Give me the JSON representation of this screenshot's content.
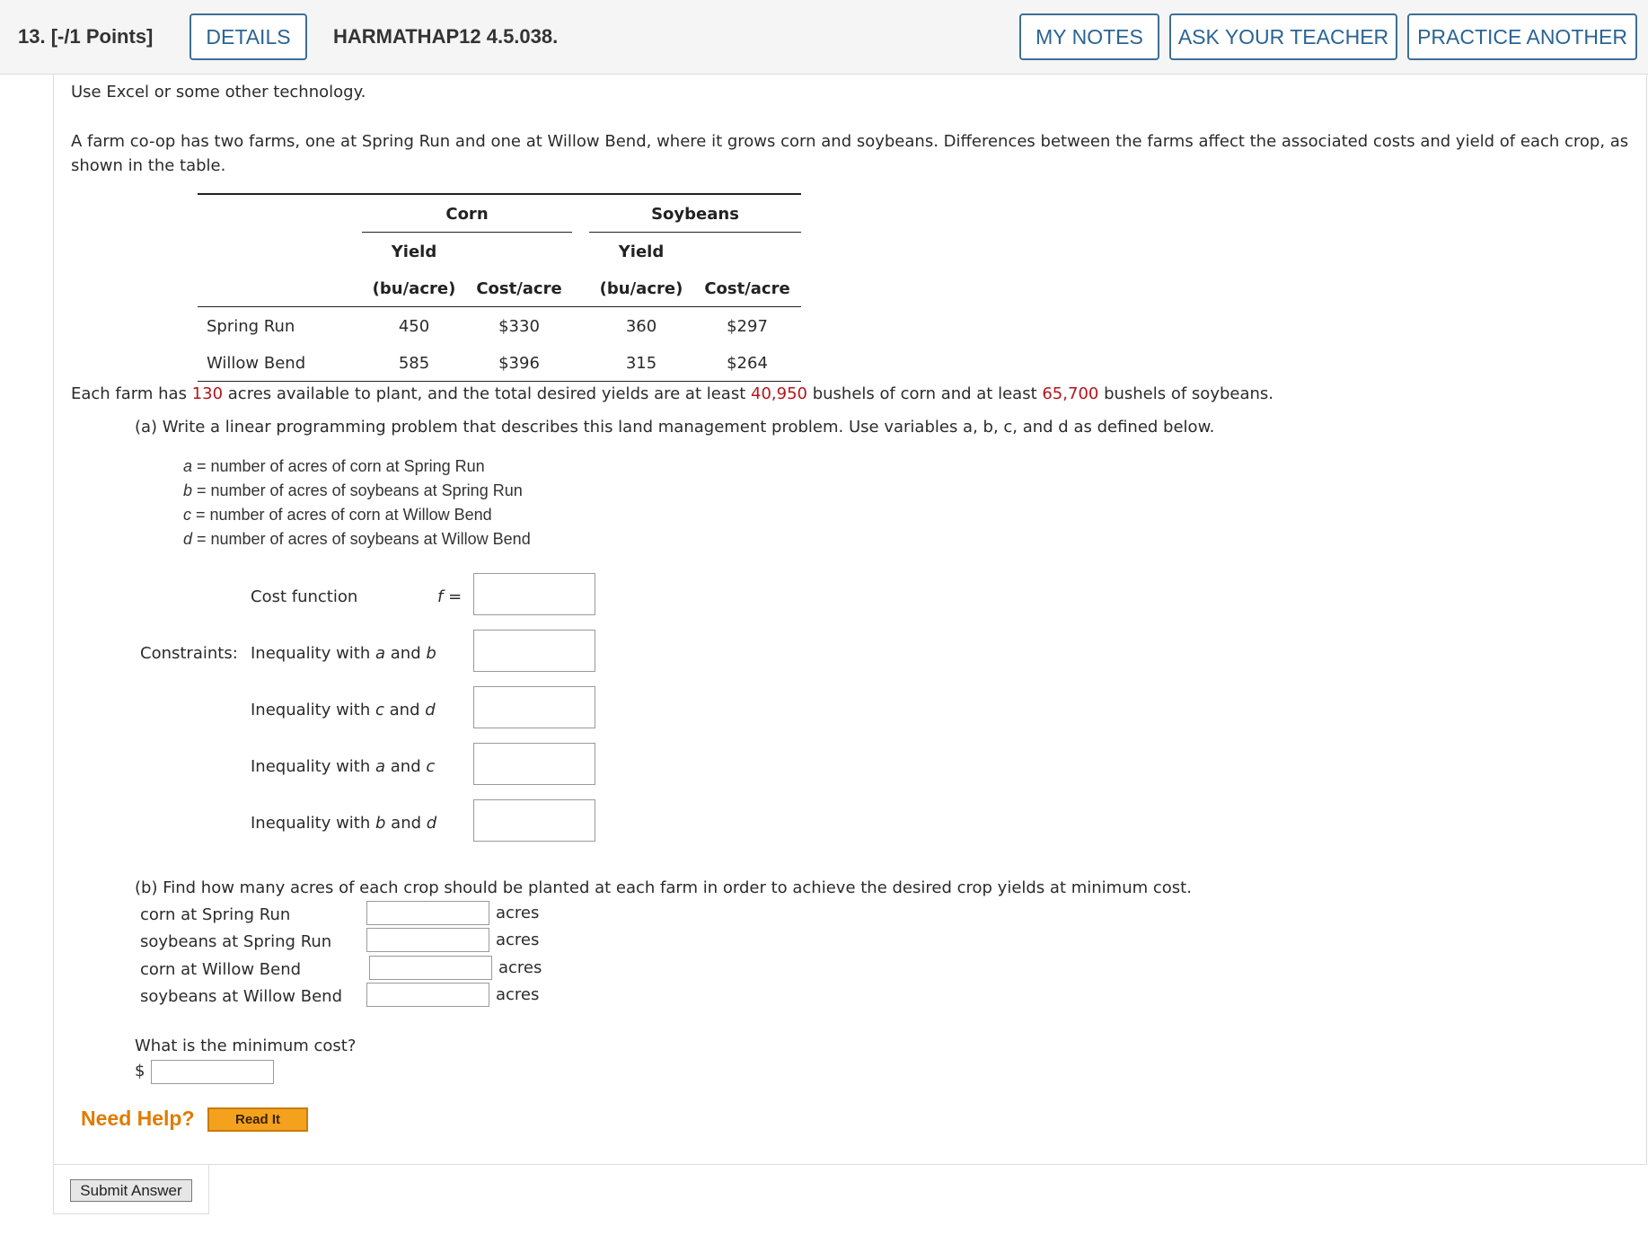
{
  "header": {
    "question_number": "13.",
    "points": "[-/1 Points]",
    "details_label": "DETAILS",
    "question_code": "HARMATHAP12 4.5.038.",
    "my_notes_label": "MY NOTES",
    "ask_teacher_label": "ASK YOUR TEACHER",
    "practice_label": "PRACTICE ANOTHER"
  },
  "intro": {
    "line1": "Use Excel or some other technology.",
    "line2a": "A farm co-op has two farms, one at Spring Run and one at Willow Bend, where it grows corn and soybeans. Differences between the farms affect the associated costs and yield of each crop, as",
    "line2b": "shown in the table."
  },
  "table": {
    "corn": "Corn",
    "soybeans": "Soybeans",
    "yield": "Yield",
    "unit": "(bu/acre)",
    "cost": "Cost/acre",
    "rows": [
      {
        "farm": "Spring Run",
        "corn_yield": "450",
        "corn_cost": "$330",
        "soy_yield": "360",
        "soy_cost": "$297"
      },
      {
        "farm": "Willow Bend",
        "corn_yield": "585",
        "corn_cost": "$396",
        "soy_yield": "315",
        "soy_cost": "$264"
      }
    ]
  },
  "summary": {
    "p1": "Each farm has ",
    "acres": "130",
    "p2": " acres available to plant, and the total desired yields are at least ",
    "corn_bushels": "40,950",
    "p3": " bushels of corn and at least ",
    "soy_bushels": "65,700",
    "p4": " bushels of soybeans."
  },
  "part_a": {
    "prompt": "(a) Write a linear programming problem that describes this land management problem. Use variables a, b, c, and d as defined below.",
    "defs": [
      {
        "var": "a",
        "text": " = number of acres of corn at Spring Run"
      },
      {
        "var": "b",
        "text": " = number of acres of soybeans at Spring Run"
      },
      {
        "var": "c",
        "text": " = number of acres of corn at Willow Bend"
      },
      {
        "var": "d",
        "text": " = number of acres of soybeans at Willow Bend"
      }
    ],
    "cost_function_label": "Cost function",
    "f_label": "f",
    "equals": "=",
    "constraints_label": "Constraints:",
    "ineq_prefix": "Inequality with ",
    "and_word": " and ",
    "ineqs": [
      {
        "v1": "a",
        "v2": "b"
      },
      {
        "v1": "c",
        "v2": "d"
      },
      {
        "v1": "a",
        "v2": "c"
      },
      {
        "v1": "b",
        "v2": "d"
      }
    ]
  },
  "part_b": {
    "prompt": "(b) Find how many acres of each crop should be planted at each farm in order to achieve the desired crop yields at minimum cost.",
    "rows": [
      {
        "label": "corn at Spring Run",
        "unit": "acres"
      },
      {
        "label": "soybeans at Spring Run",
        "unit": "acres"
      },
      {
        "label": "corn at Willow Bend",
        "unit": "acres"
      },
      {
        "label": "soybeans at Willow Bend",
        "unit": "acres"
      }
    ],
    "min_cost_question": "What is the minimum cost?",
    "dollar": "$"
  },
  "help": {
    "need_help": "Need Help?",
    "read_it": "Read It"
  },
  "submit_label": "Submit Answer"
}
